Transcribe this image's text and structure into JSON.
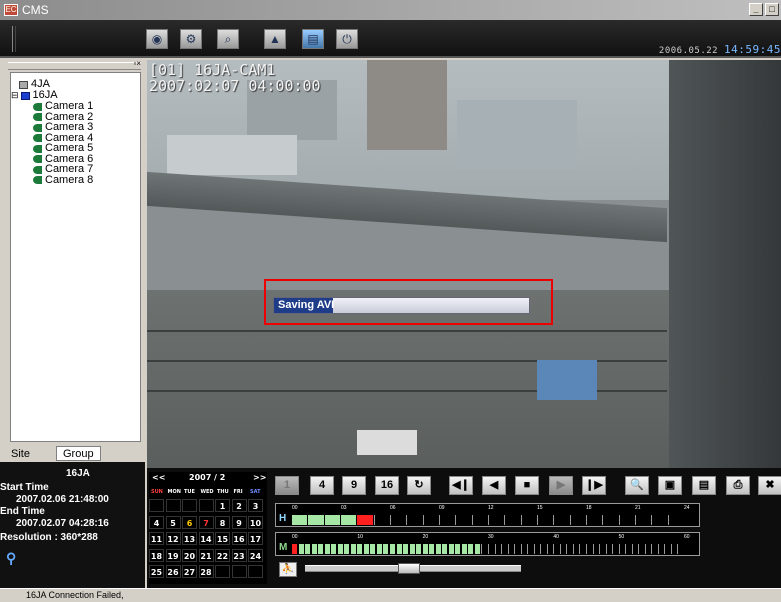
{
  "window": {
    "title": "CMS",
    "app_icon_text": "EC"
  },
  "toolbar": {
    "icons": [
      "connect-icon",
      "setup-icon",
      "search-icon",
      "multi-view-icon",
      "playback-icon",
      "power-icon"
    ],
    "clock_date": "2006.05.22",
    "clock_time": "14:59:45"
  },
  "tree": {
    "sites": [
      {
        "label": "4JA"
      },
      {
        "label": "16JA",
        "cameras": [
          "Camera 1",
          "Camera 2",
          "Camera 3",
          "Camera 4",
          "Camera 5",
          "Camera 6",
          "Camera 7",
          "Camera 8"
        ]
      }
    ]
  },
  "tabs": {
    "site": "Site",
    "group": "Group"
  },
  "info": {
    "site_name": "16JA",
    "start_label": "Start Time",
    "start_value": "2007.02.06 21:48:00",
    "end_label": "End Time",
    "end_value": "2007.02.07 04:28:16",
    "resolution": "Resolution : 360*288"
  },
  "status": {
    "text": "16JA Connection Failed,"
  },
  "video": {
    "camera_label": "[01] 16JA-CAM1",
    "timestamp": "2007:02:07 04:00:00",
    "saving_text": "Saving AVI",
    "saving_progress": 0.23
  },
  "calendar": {
    "prev": "<<",
    "next": ">>",
    "month_label": "2007 / 2",
    "weekdays": [
      "SUN",
      "MON",
      "TUE",
      "WED",
      "THU",
      "FRI",
      "SAT"
    ],
    "rows": [
      [
        "",
        "",
        "",
        "",
        "1",
        "2",
        "3"
      ],
      [
        "4",
        "5",
        "6",
        "7",
        "8",
        "9",
        "10"
      ],
      [
        "11",
        "12",
        "13",
        "14",
        "15",
        "16",
        "17"
      ],
      [
        "18",
        "19",
        "20",
        "21",
        "22",
        "23",
        "24"
      ],
      [
        "25",
        "26",
        "27",
        "28",
        "",
        "",
        ""
      ]
    ],
    "highlight": {
      "6": "#ffcc00",
      "7": "#ff3333"
    }
  },
  "playback": {
    "buttons": [
      {
        "name": "split-1-button",
        "label": "1",
        "dim": true
      },
      {
        "name": "split-4-button",
        "label": "4"
      },
      {
        "name": "split-9-button",
        "label": "9"
      },
      {
        "name": "split-16-button",
        "label": "16"
      },
      {
        "name": "rotate-icon",
        "label": "↻"
      },
      {
        "name": "step-back-icon",
        "label": "◀❙"
      },
      {
        "name": "reverse-play-icon",
        "label": "◀"
      },
      {
        "name": "stop-icon",
        "label": "■"
      },
      {
        "name": "play-icon",
        "label": "▶",
        "dim": true
      },
      {
        "name": "step-forward-icon",
        "label": "❙▶"
      },
      {
        "name": "zoom-icon",
        "label": "🔍"
      },
      {
        "name": "snapshot-icon",
        "label": "▣"
      },
      {
        "name": "export-icon",
        "label": "▤"
      },
      {
        "name": "print-icon",
        "label": "⎙"
      },
      {
        "name": "close-playback-icon",
        "label": "✖"
      }
    ]
  },
  "timeline_hour": {
    "label": "H",
    "ticks": [
      "00",
      "03",
      "06",
      "09",
      "12",
      "15",
      "18",
      "21",
      "24"
    ],
    "recorded_hours": [
      0,
      1,
      2,
      3
    ],
    "current_hour": 4,
    "recorded_color": "#a6e7a6",
    "current_color": "#ff2020"
  },
  "timeline_minute": {
    "label": "M",
    "ticks": [
      "00",
      "10",
      "20",
      "30",
      "40",
      "50",
      "60"
    ],
    "current_minute": 0,
    "recorded_to_minute": 28,
    "recorded_color": "#a6e7a6",
    "current_color": "#ff2020"
  },
  "speed": {
    "level": 0.48
  }
}
